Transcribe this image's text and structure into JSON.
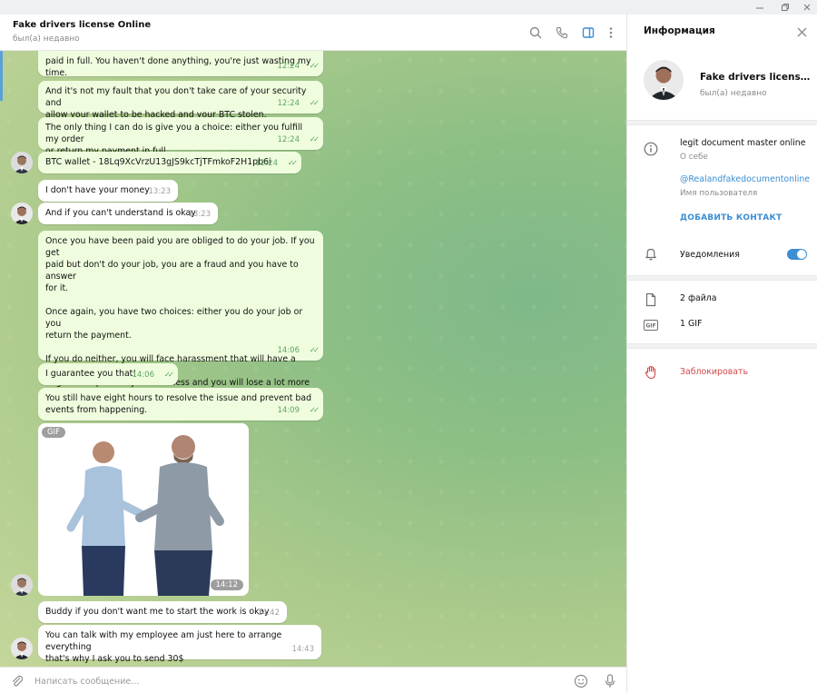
{
  "chat": {
    "title": "Fake drivers license Online",
    "status": "был(а) недавно"
  },
  "messages": [
    {
      "text": "paid in full. You haven't done anything, you're just wasting my time.",
      "time": "12:24"
    },
    {
      "text": "And it's not my fault that you don't take care of your security and\nallow your wallet to be hacked and your BTC stolen.",
      "time": "12:24"
    },
    {
      "text": "The only thing I can do is give you a choice: either you fulfill my order\nor return my payment in full.",
      "time": "12:24"
    },
    {
      "text": "BTC wallet - 18Lq9XcVrzU13gJS9kcTjTFmkoF2H1pb6i",
      "time": "12:24"
    },
    {
      "text": "I don't have your money",
      "time": "13:23"
    },
    {
      "text": "And if you can't understand is okay",
      "time": "13:23"
    },
    {
      "text": "Once you have been paid you are obliged to do your job. If you get\npaid but don't do your job, you are a fraud and you have to answer\nfor it.\n\nOnce again, you have two choices: either you do your job or you\nreturn the payment.\n\nIf you do neither, you will face harassment that will have a very\nnegative impact on your business and you will lose a lot more than\nthe $50 you got from me.",
      "time": "14:06"
    },
    {
      "text": "I guarantee you that!",
      "time": "14:06"
    },
    {
      "text": "You still have eight hours to resolve the issue and prevent bad\nevents from happening.",
      "time": "14:09"
    },
    {
      "text": "Buddy if you don't want me to start the work is okay",
      "time": "14:42"
    },
    {
      "text": "You can talk with my employee am just here to arrange everything\nthat's why I ask you to send 30$",
      "time": "14:43"
    }
  ],
  "gif": {
    "badge": "GIF",
    "time": "14:12"
  },
  "composer": {
    "placeholder": "Написать сообщение..."
  },
  "info_panel": {
    "title": "Информация",
    "name": "Fake drivers license Online",
    "status": "был(а) недавно",
    "bio": "legit document master online",
    "bio_label": "О себе",
    "username": "@Realandfakedocumentonline",
    "username_label": "Имя пользователя",
    "add_contact": "ДОБАВИТЬ КОНТАКТ",
    "notifications": "Уведомления",
    "notifications_on": true,
    "files": "2 файла",
    "gifs": "1 GIF",
    "block": "Заблокировать"
  },
  "colors": {
    "accent": "#3a8ed4",
    "outgoing_bubble": "#effdde",
    "danger": "#d24949",
    "tick": "#5fa463"
  }
}
